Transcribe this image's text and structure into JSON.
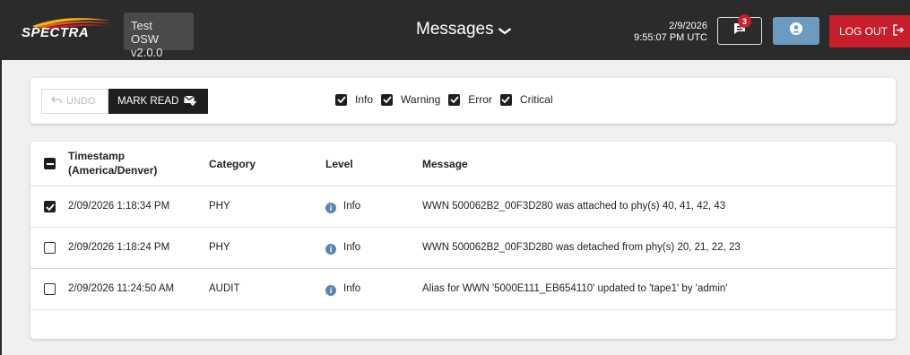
{
  "header": {
    "logo_text": "SPECTRA",
    "system_name": "Test",
    "version": "OSW v2.0.0",
    "title": "Messages",
    "date": "2/9/2026",
    "time": "9:55:07 PM UTC",
    "message_count": "3",
    "logout_label": "LOG OUT"
  },
  "toolbar": {
    "undo_label": "UNDO",
    "mark_read_label": "MARK READ",
    "filters": [
      {
        "label": "Info",
        "checked": true
      },
      {
        "label": "Warning",
        "checked": true
      },
      {
        "label": "Error",
        "checked": true
      },
      {
        "label": "Critical",
        "checked": true
      }
    ]
  },
  "table": {
    "columns": [
      "Timestamp\n(America/Denver)",
      "Category",
      "Level",
      "Message"
    ],
    "col_timestamp_line1": "Timestamp",
    "col_timestamp_line2": "(America/Denver)",
    "col_category": "Category",
    "col_level": "Level",
    "col_message": "Message",
    "rows": [
      {
        "checked": true,
        "timestamp": "2/09/2026 1:18:34 PM",
        "category": "PHY",
        "level": "Info",
        "message": "WWN 500062B2_00F3D280 was attached to phy(s) 40, 41, 42, 43"
      },
      {
        "checked": false,
        "timestamp": "2/09/2026 1:18:24 PM",
        "category": "PHY",
        "level": "Info",
        "message": "WWN 500062B2_00F3D280 was detached from phy(s) 20, 21, 22, 23"
      },
      {
        "checked": false,
        "timestamp": "2/09/2026 11:24:50 AM",
        "category": "AUDIT",
        "level": "Info",
        "message": "Alias for WWN '5000E111_EB654110' updated to 'tape1' by 'admin'"
      }
    ]
  },
  "colors": {
    "header_bg": "#2b2b2b",
    "logout_red": "#c81e2b",
    "user_blue": "#6b9bc0",
    "info_blue": "#5a85b0"
  }
}
